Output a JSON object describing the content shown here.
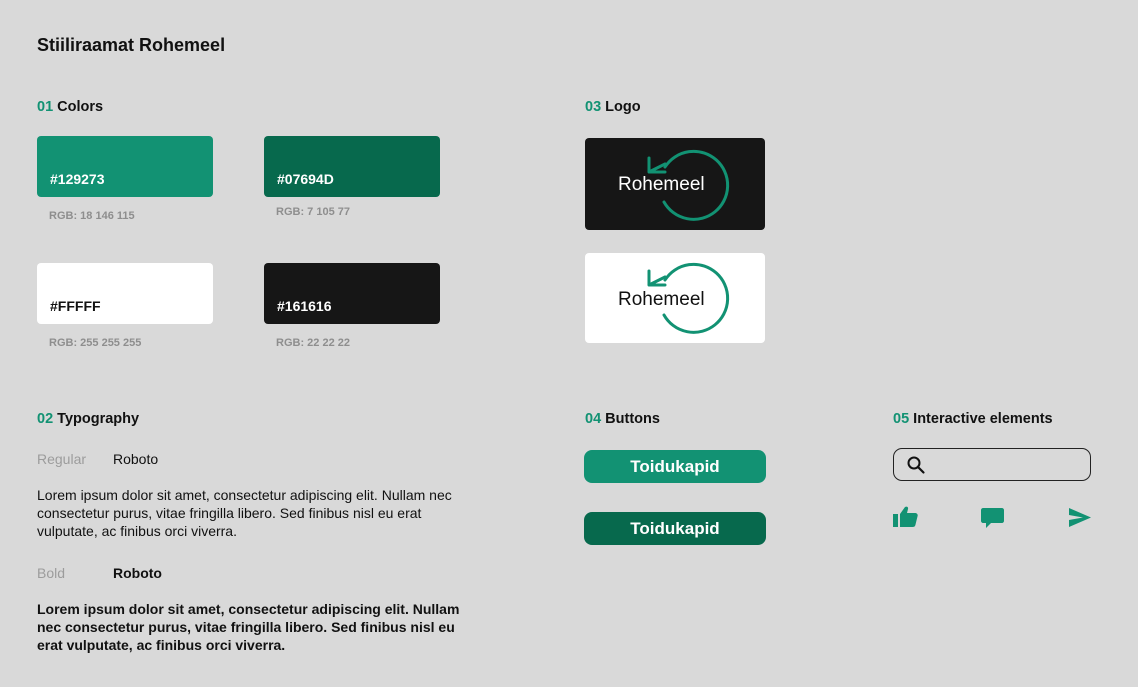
{
  "page_title": "Stiiliraamat Rohemeel",
  "sections": {
    "colors": {
      "num": "01",
      "title": "Colors"
    },
    "typography": {
      "num": "02",
      "title": "Typography"
    },
    "logo": {
      "num": "03",
      "title": "Logo"
    },
    "buttons": {
      "num": "04",
      "title": "Buttons"
    },
    "interactive": {
      "num": "05",
      "title": "Interactive elements"
    }
  },
  "colors": [
    {
      "hex": "#129273",
      "rgb": "RGB: 18 146 115",
      "text_color": "#ffffff"
    },
    {
      "hex": "#07694D",
      "rgb": "RGB: 7 105 77",
      "text_color": "#ffffff"
    },
    {
      "hex": "#FFFFF",
      "rgb": "RGB: 255 255 255",
      "text_color": "#111111",
      "fill": "#ffffff"
    },
    {
      "hex": "#161616",
      "rgb": "RGB: 22 22 22",
      "text_color": "#ffffff"
    }
  ],
  "logo": {
    "text": "Rohemeel",
    "accent": "#129273",
    "dark_bg": "#161616",
    "light_bg": "#ffffff"
  },
  "typography": {
    "regular_label": "Regular",
    "regular_font": "Roboto",
    "bold_label": "Bold",
    "bold_font": "Roboto",
    "sample": "Lorem ipsum dolor sit amet, consectetur adipiscing elit. Nullam nec consectetur purus, vitae fringilla libero. Sed finibus nisl eu erat vulputate, ac finibus orci viverra."
  },
  "buttons": [
    {
      "label": "Toidukapid",
      "color": "#129273"
    },
    {
      "label": "Toidukapid",
      "color": "#07694D"
    }
  ],
  "interactive": {
    "search_placeholder": "",
    "icons": [
      "thumbs-up-icon",
      "comment-icon",
      "send-icon"
    ],
    "icon_color": "#129273"
  }
}
